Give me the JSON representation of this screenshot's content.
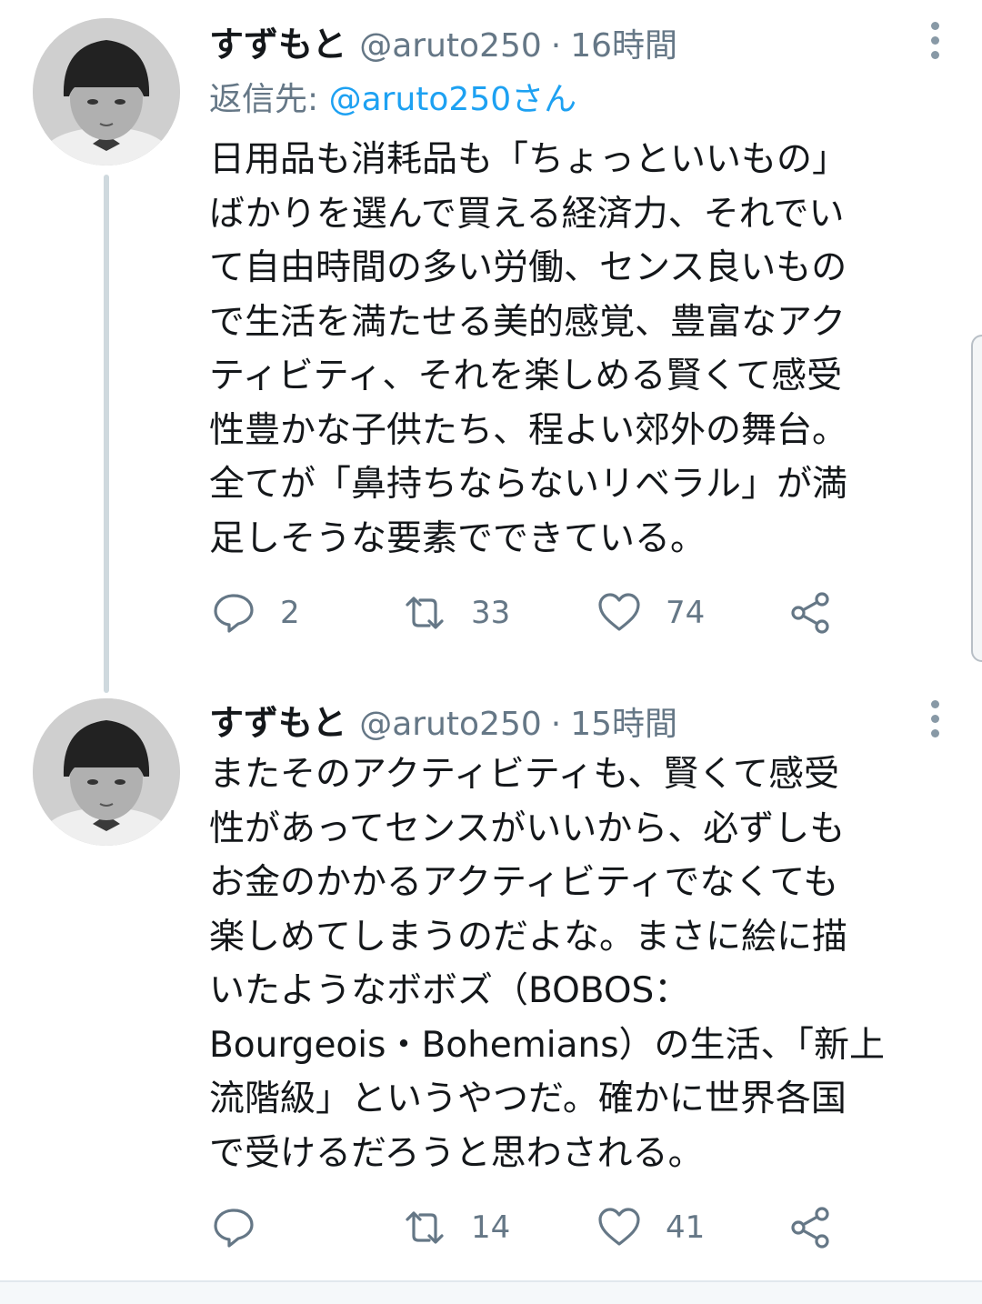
{
  "tweets": [
    {
      "name": "すずもと",
      "handle": "@aruto250",
      "separator": "·",
      "time": "16時間",
      "reply_label": "返信先:",
      "reply_mention": "@aruto250さん",
      "text": "日用品も消耗品も「ちょっといいもの」\nばかりを選んで買える経済力、それでい\nて自由時間の多い労働、センス良いもの\nで生活を満たせる美的感覚、豊富なアク\nティビティ、それを楽しめる賢くて感受\n性豊かな子供たち、程よい郊外の舞台。\n全てが「鼻持ちならないリベラル」が満\n足しそうな要素でできている。",
      "replies": "2",
      "retweets": "33",
      "likes": "74"
    },
    {
      "name": "すずもと",
      "handle": "@aruto250",
      "separator": "·",
      "time": "15時間",
      "text": "またそのアクティビティも、賢くて感受\n性があってセンスがいいから、必ずしも\nお金のかかるアクティビティでなくても\n楽しめてしまうのだよな。まさに絵に描\nいたようなボボズ（BOBOS：\nBourgeois・Bohemians）の生活、「新上\n流階級」というやつだ。確かに世界各国\nで受けるだろうと思わされる。",
      "replies": "",
      "retweets": "14",
      "likes": "41"
    }
  ],
  "colors": {
    "text": "#14171a",
    "secondary": "#657786",
    "link": "#1da1f2",
    "thread_line": "#cfd9de"
  },
  "icons": [
    "more-vertical-icon",
    "reply-icon",
    "retweet-icon",
    "like-icon",
    "share-icon"
  ]
}
